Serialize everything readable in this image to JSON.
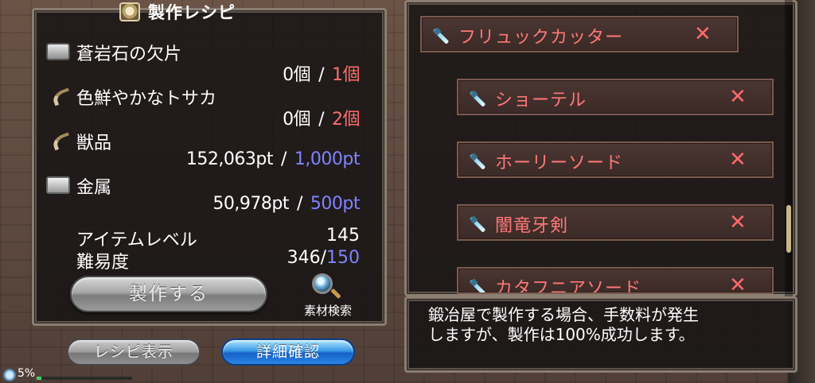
{
  "title": "製作レシピ",
  "materials": [
    {
      "name": "蒼岩石の欠片",
      "icon": "ore-icon",
      "have": "0個",
      "need": "1個",
      "need_color": "red"
    },
    {
      "name": "色鮮やかなトサカ",
      "icon": "fang-icon",
      "have": "0個",
      "need": "2個",
      "need_color": "red"
    },
    {
      "name": "獣品",
      "icon": "fang-icon",
      "have": "152,063pt",
      "need": "1,000pt",
      "need_color": "blue"
    },
    {
      "name": "金属",
      "icon": "metal-icon",
      "have": "50,978pt",
      "need": "500pt",
      "need_color": "blue"
    }
  ],
  "separator": "/",
  "stats": {
    "item_level_label": "アイテムレベル",
    "item_level_value": "145",
    "difficulty_label": "難易度",
    "difficulty_have": "346/",
    "difficulty_need": "150"
  },
  "buttons": {
    "make": "製作する",
    "search": "素材検索",
    "recipe": "レシピ表示",
    "detail": "詳細確認"
  },
  "recipe_list": [
    {
      "name": "フリュックカッター",
      "close": "✕"
    },
    {
      "name": "ショーテル",
      "close": "✕"
    },
    {
      "name": "ホーリーソード",
      "close": "✕"
    },
    {
      "name": "闇竜牙剣",
      "close": "✕"
    },
    {
      "name": "カタフニアソード",
      "close": "✕"
    }
  ],
  "info": {
    "line1": "鍛冶屋で製作する場合、手数料が発生",
    "line2": "しますが、製作は100%成功します。"
  },
  "status": {
    "percent": "5%"
  },
  "colors": {
    "red": "#ff6d6d",
    "blue": "#7f83ff",
    "item_text": "#ff7878",
    "detail_button": "#2b86e6"
  }
}
